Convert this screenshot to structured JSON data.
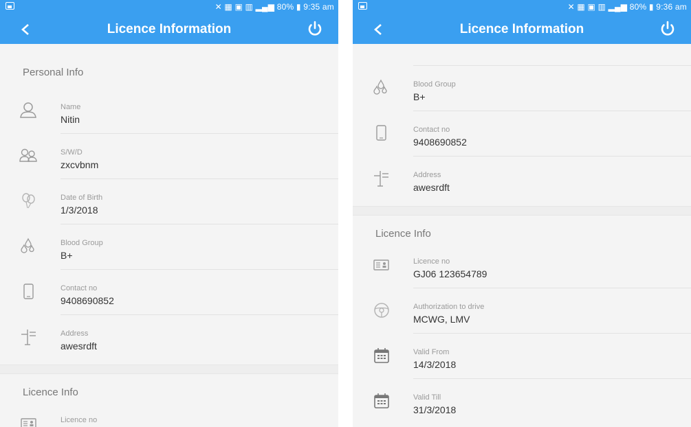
{
  "left": {
    "status_time": "9:35 am",
    "battery": "80%",
    "title": "Licence Information",
    "personal_section": "Personal Info",
    "name_label": "Name",
    "name_value": "Nitin",
    "swd_label": "S/W/D",
    "swd_value": "zxcvbnm",
    "dob_label": "Date of Birth",
    "dob_value": "1/3/2018",
    "blood_label": "Blood Group",
    "blood_value": "B+",
    "contact_label": "Contact no",
    "contact_value": "9408690852",
    "address_label": "Address",
    "address_value": "awesrdft",
    "licence_section": "Licence Info",
    "licence_label": "Licence no"
  },
  "right": {
    "status_time": "9:36 am",
    "battery": "80%",
    "title": "Licence Information",
    "blood_label": "Blood Group",
    "blood_value": "B+",
    "contact_label": "Contact no",
    "contact_value": "9408690852",
    "address_label": "Address",
    "address_value": "awesrdft",
    "licence_section": "Licence Info",
    "licence_label": "Licence no",
    "licence_value": "GJ06 123654789",
    "auth_label": "Authorization to drive",
    "auth_value": "MCWG, LMV",
    "from_label": "Valid From",
    "from_value": "14/3/2018",
    "till_label": "Valid Till",
    "till_value": "31/3/2018"
  },
  "colors": {
    "app_bar": "#3a9ff0",
    "background": "#f4f4f4"
  }
}
